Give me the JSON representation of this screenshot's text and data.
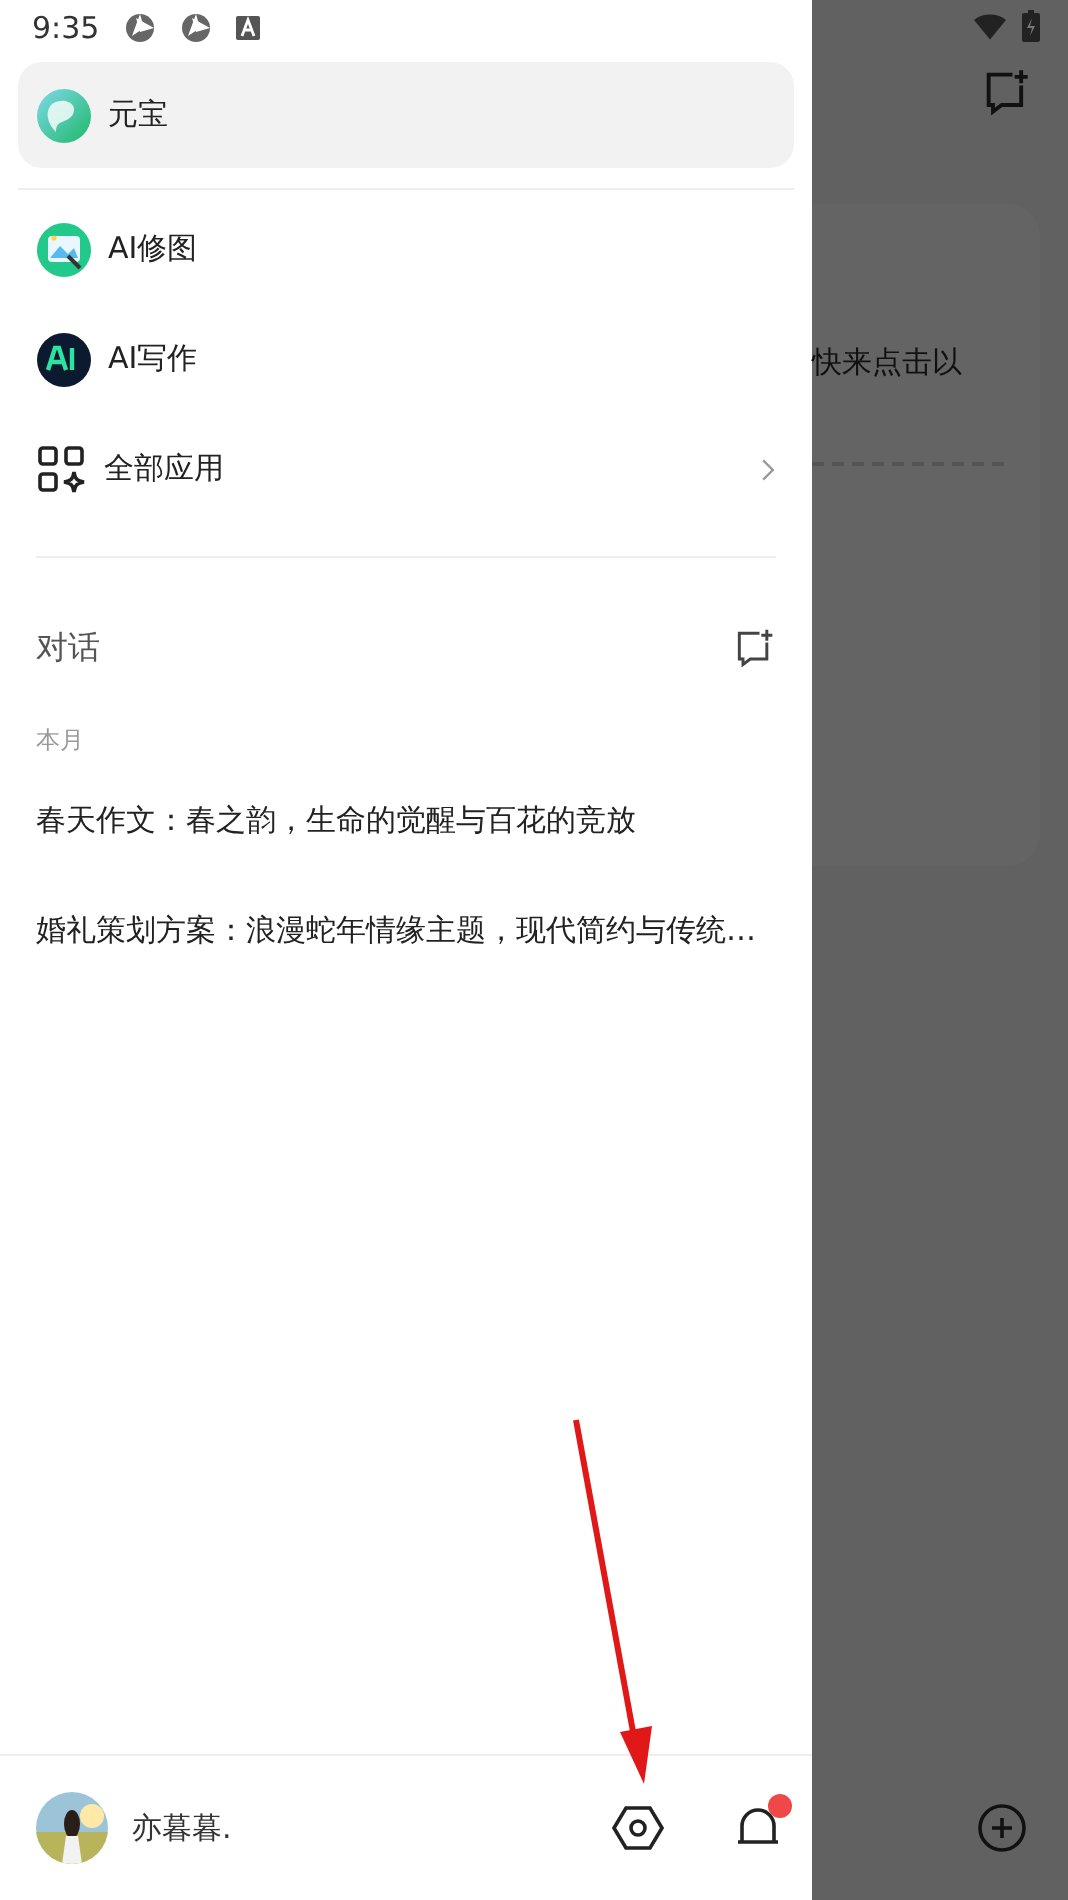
{
  "status_bar": {
    "time": "9:35"
  },
  "drawer": {
    "current_app": {
      "label": "元宝",
      "selected": true
    },
    "apps": [
      {
        "label": "AI修图",
        "kind": "photo"
      },
      {
        "label": "AI写作",
        "kind": "write"
      },
      {
        "label": "全部应用",
        "kind": "all"
      }
    ],
    "conversations_header": "对话",
    "groups": [
      {
        "label": "本月",
        "items": [
          "春天作文：春之韵，生命的觉醒与百花的竞放",
          "婚礼策划方案：浪漫蛇年情缘主题，现代简约与传统…"
        ]
      }
    ],
    "user": {
      "name": "亦暮暮."
    }
  },
  "background": {
    "card_text": "快来点击以"
  }
}
